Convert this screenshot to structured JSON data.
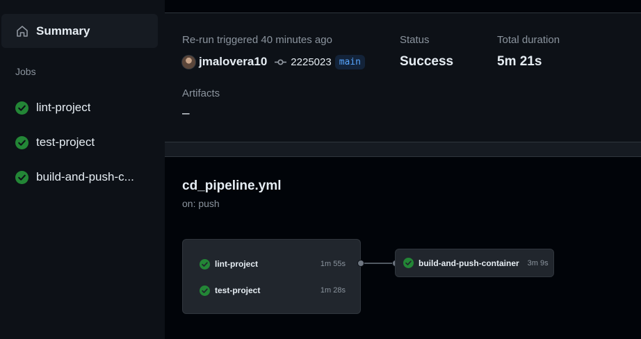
{
  "sidebar": {
    "summary_label": "Summary",
    "jobs_heading": "Jobs",
    "jobs": [
      {
        "label": "lint-project",
        "status": "success"
      },
      {
        "label": "test-project",
        "status": "success"
      },
      {
        "label": "build-and-push-c...",
        "status": "success"
      }
    ]
  },
  "run_summary": {
    "trigger_text": "Re-run triggered 40 minutes ago",
    "user": "jmalovera10",
    "commit_sha": "2225023",
    "branch": "main",
    "status_label": "Status",
    "status_value": "Success",
    "duration_label": "Total duration",
    "duration_value": "5m 21s",
    "artifacts_label": "Artifacts",
    "artifacts_value": "–"
  },
  "workflow": {
    "filename": "cd_pipeline.yml",
    "trigger": "on: push",
    "group_jobs": [
      {
        "name": "lint-project",
        "duration": "1m 55s"
      },
      {
        "name": "test-project",
        "duration": "1m 28s"
      }
    ],
    "downstream_job": {
      "name": "build-and-push-container",
      "duration": "3m 9s"
    }
  },
  "colors": {
    "success": "#238636",
    "branch_text": "#58a6ff",
    "background": "#010409",
    "panel": "#0d1117"
  }
}
